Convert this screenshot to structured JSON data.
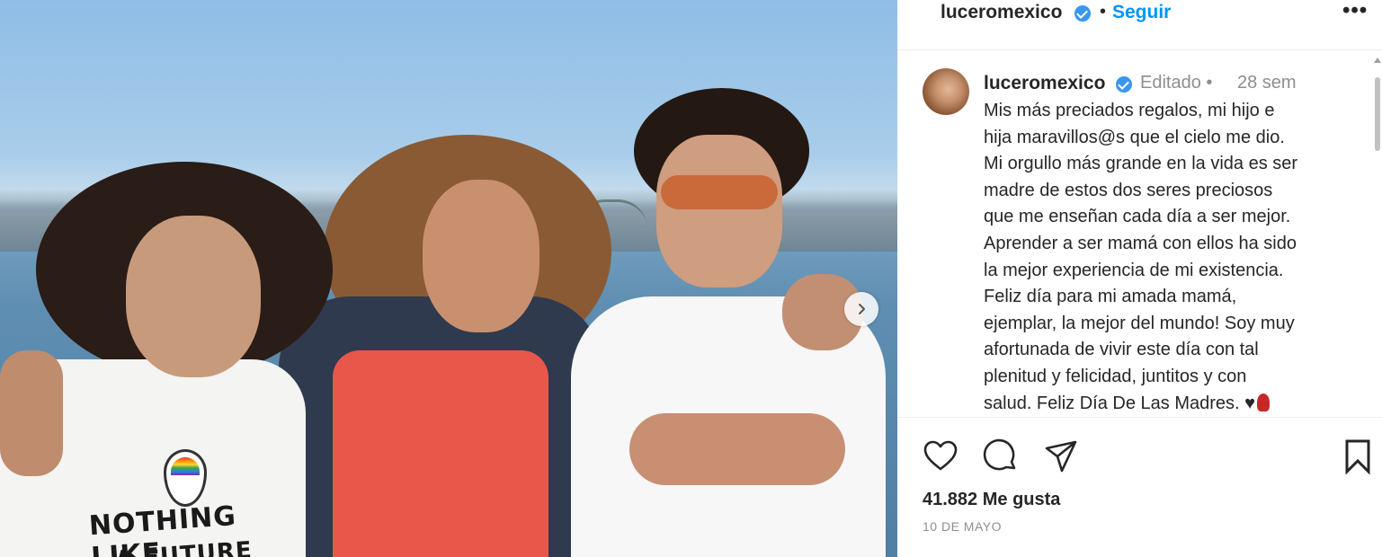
{
  "photo": {
    "shirt_text_line1": "NOTHING LIKE",
    "shirt_text_line2": "A FUTURE",
    "next_icon": "chevron-right-icon"
  },
  "header": {
    "username": "luceromexico",
    "verified_icon": "verified-badge-icon",
    "separator": "•",
    "follow_label": "Seguir",
    "more_label": "•••"
  },
  "post": {
    "username": "luceromexico",
    "edited_label": "Editado",
    "separator": "•",
    "time_ago": "28 sem",
    "caption_lines": [
      "Mis más preciados regalos, mi hijo e",
      "hija maravillos@s que el cielo me dio.",
      "Mi orgullo más grande en la vida es ser",
      "madre de estos dos seres preciosos",
      "que me enseñan cada día a ser mejor.",
      "Aprender a ser mamá con ellos ha sido",
      "la mejor experiencia de mi existencia.",
      "Feliz día para mi amada mamá,",
      "ejemplar, la mejor del mundo! Soy muy",
      "afortunada de vivir este día con tal",
      "plenitud y felicidad, juntitos y con",
      "salud. Feliz Día De Las Madres. ♥"
    ],
    "likes": "41.882 Me gusta",
    "date": "10 DE MAYO"
  },
  "actions": {
    "like_icon": "heart-icon",
    "comment_icon": "comment-icon",
    "share_icon": "send-icon",
    "save_icon": "bookmark-icon"
  },
  "colors": {
    "accent": "#0095f6",
    "verified": "#3897f0",
    "muted": "#8e8e8e",
    "text": "#262626"
  }
}
